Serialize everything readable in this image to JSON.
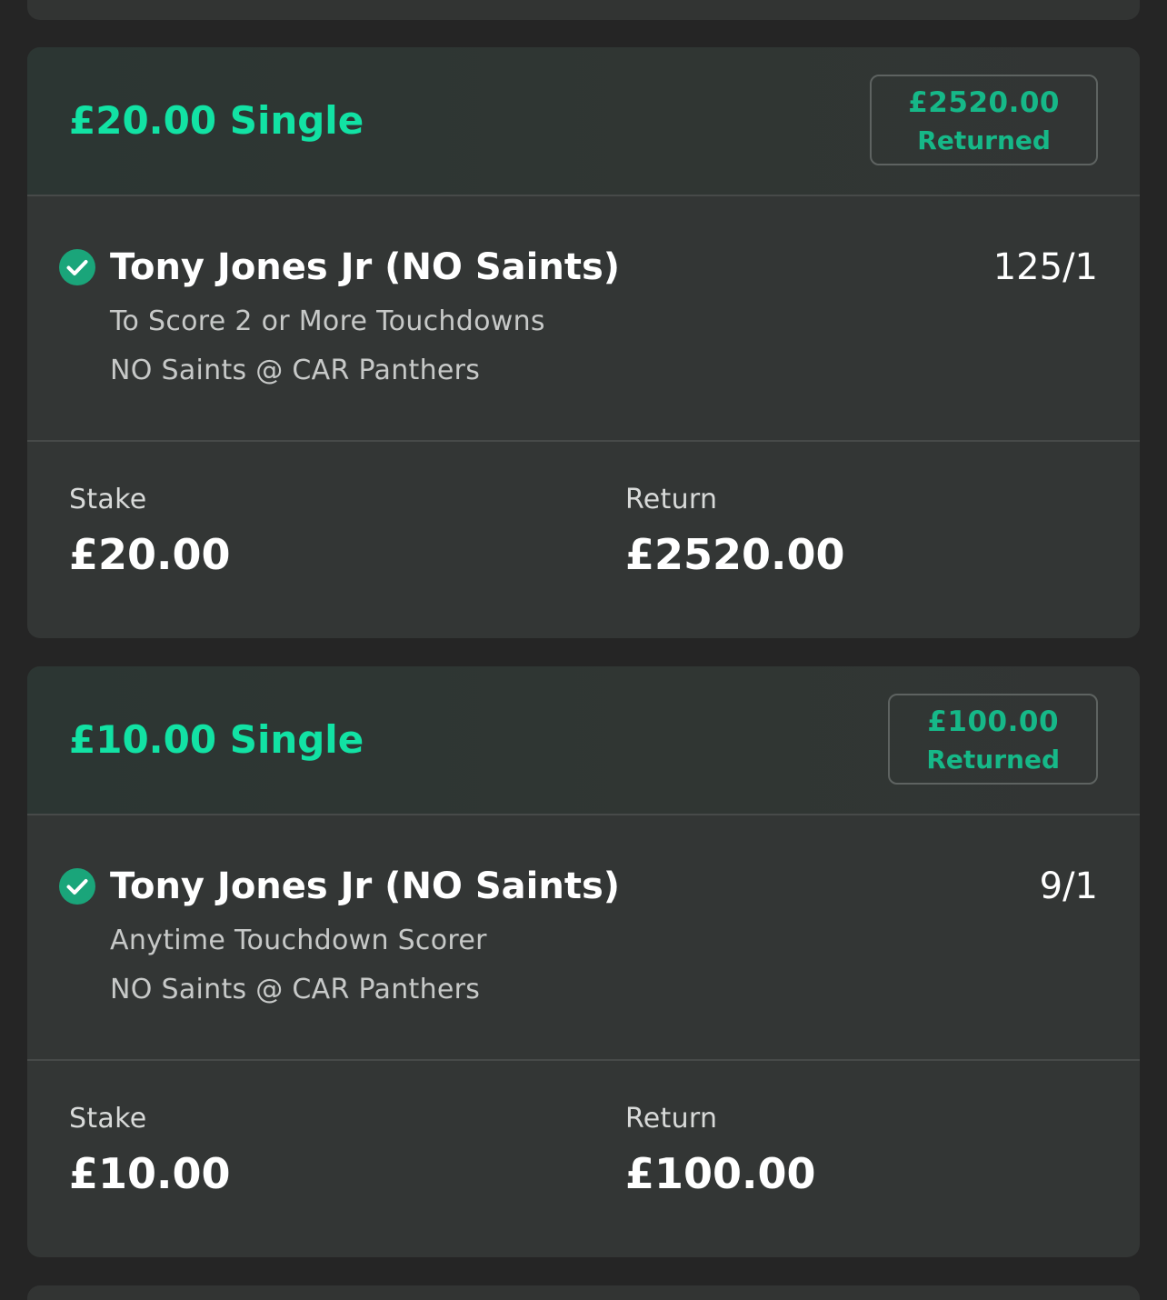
{
  "bets": [
    {
      "title": "£20.00 Single",
      "returned_amount": "£2520.00",
      "returned_label": "Returned",
      "selection": "Tony Jones Jr (NO Saints)",
      "odds": "125/1",
      "market": "To Score 2 or More Touchdowns",
      "event": "NO Saints @ CAR Panthers",
      "stake_label": "Stake",
      "stake_value": "£20.00",
      "return_label": "Return",
      "return_value": "£2520.00",
      "status_icon": "check-circle-icon"
    },
    {
      "title": "£10.00 Single",
      "returned_amount": "£100.00",
      "returned_label": "Returned",
      "selection": "Tony Jones Jr (NO Saints)",
      "odds": "9/1",
      "market": "Anytime Touchdown Scorer",
      "event": "NO Saints @ CAR Panthers",
      "stake_label": "Stake",
      "stake_value": "£10.00",
      "return_label": "Return",
      "return_value": "£100.00",
      "status_icon": "check-circle-icon"
    }
  ],
  "colors": {
    "background": "#252525",
    "card": "#333635",
    "accent_green": "#12e2a4",
    "returned_green": "#16b888",
    "check_green": "#1aa57a"
  }
}
